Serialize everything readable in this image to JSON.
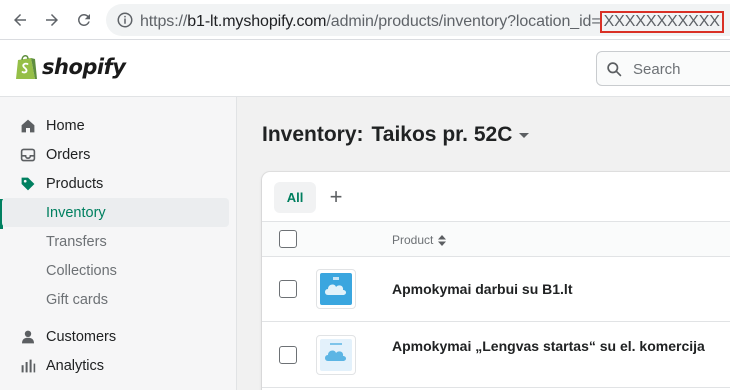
{
  "browser": {
    "url_host": "b1-lt.myshopify.com",
    "url_path": "/admin/products/inventory?location_id=",
    "url_redacted": "XXXXXXXXXXX",
    "url_prefix": "https://"
  },
  "header": {
    "logo_text": "shopify",
    "search_placeholder": "Search"
  },
  "sidebar": {
    "items": [
      {
        "label": "Home",
        "icon": "home-icon"
      },
      {
        "label": "Orders",
        "icon": "inbox-icon"
      },
      {
        "label": "Products",
        "icon": "tag-icon"
      },
      {
        "label": "Inventory",
        "active": true
      },
      {
        "label": "Transfers"
      },
      {
        "label": "Collections"
      },
      {
        "label": "Gift cards"
      },
      {
        "label": "Customers",
        "icon": "person-icon"
      },
      {
        "label": "Analytics",
        "icon": "bar-chart-icon"
      }
    ]
  },
  "main": {
    "title": "Inventory:",
    "location": "Taikos pr. 52C",
    "tabs": [
      {
        "label": "All"
      }
    ],
    "columns": {
      "product": "Product"
    },
    "products": [
      {
        "name": "Apmokymai darbui su B1.lt"
      },
      {
        "name": "Apmokymai „Lengvas startas“ su el. komercija"
      }
    ]
  },
  "colors": {
    "accent": "#008060",
    "redaction_border": "#d93025"
  }
}
